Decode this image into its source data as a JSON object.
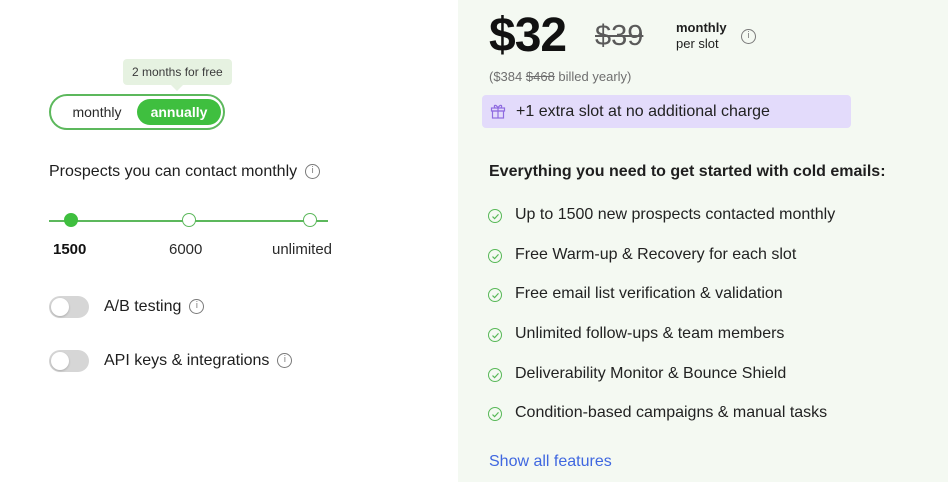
{
  "billing": {
    "tooltip": "2 months for free",
    "option_monthly": "monthly",
    "option_annually": "annually",
    "selected": "annually"
  },
  "prospects": {
    "title": "Prospects you can contact monthly",
    "options": [
      "1500",
      "6000",
      "unlimited"
    ],
    "selected": "1500"
  },
  "toggles": [
    {
      "label": "A/B testing",
      "on": false
    },
    {
      "label": "API keys & integrations",
      "on": false
    }
  ],
  "pricing": {
    "price": "$32",
    "old_price": "$39",
    "period_line1": "monthly",
    "period_line2": "per slot",
    "billed_prefix": "($384 ",
    "billed_old": "$468",
    "billed_suffix": " billed yearly)",
    "extra_offer": "+1 extra slot at no additional charge"
  },
  "features": {
    "title": "Everything you need to get started with cold emails:",
    "items": [
      "Up to 1500 new prospects contacted monthly",
      "Free Warm-up & Recovery for each slot",
      "Free email list verification & validation",
      "Unlimited follow-ups & team members",
      "Deliverability Monitor & Bounce Shield",
      "Condition-based campaigns & manual tasks"
    ],
    "show_all": "Show all features"
  },
  "icons": {
    "info": "info-icon",
    "check": "check-circle-icon",
    "gift": "gift-icon"
  },
  "colors": {
    "accent_green": "#3fbf3f",
    "link_blue": "#3f67e0",
    "offer_bg": "#e3dbfb",
    "right_bg": "#f4f9f2"
  }
}
